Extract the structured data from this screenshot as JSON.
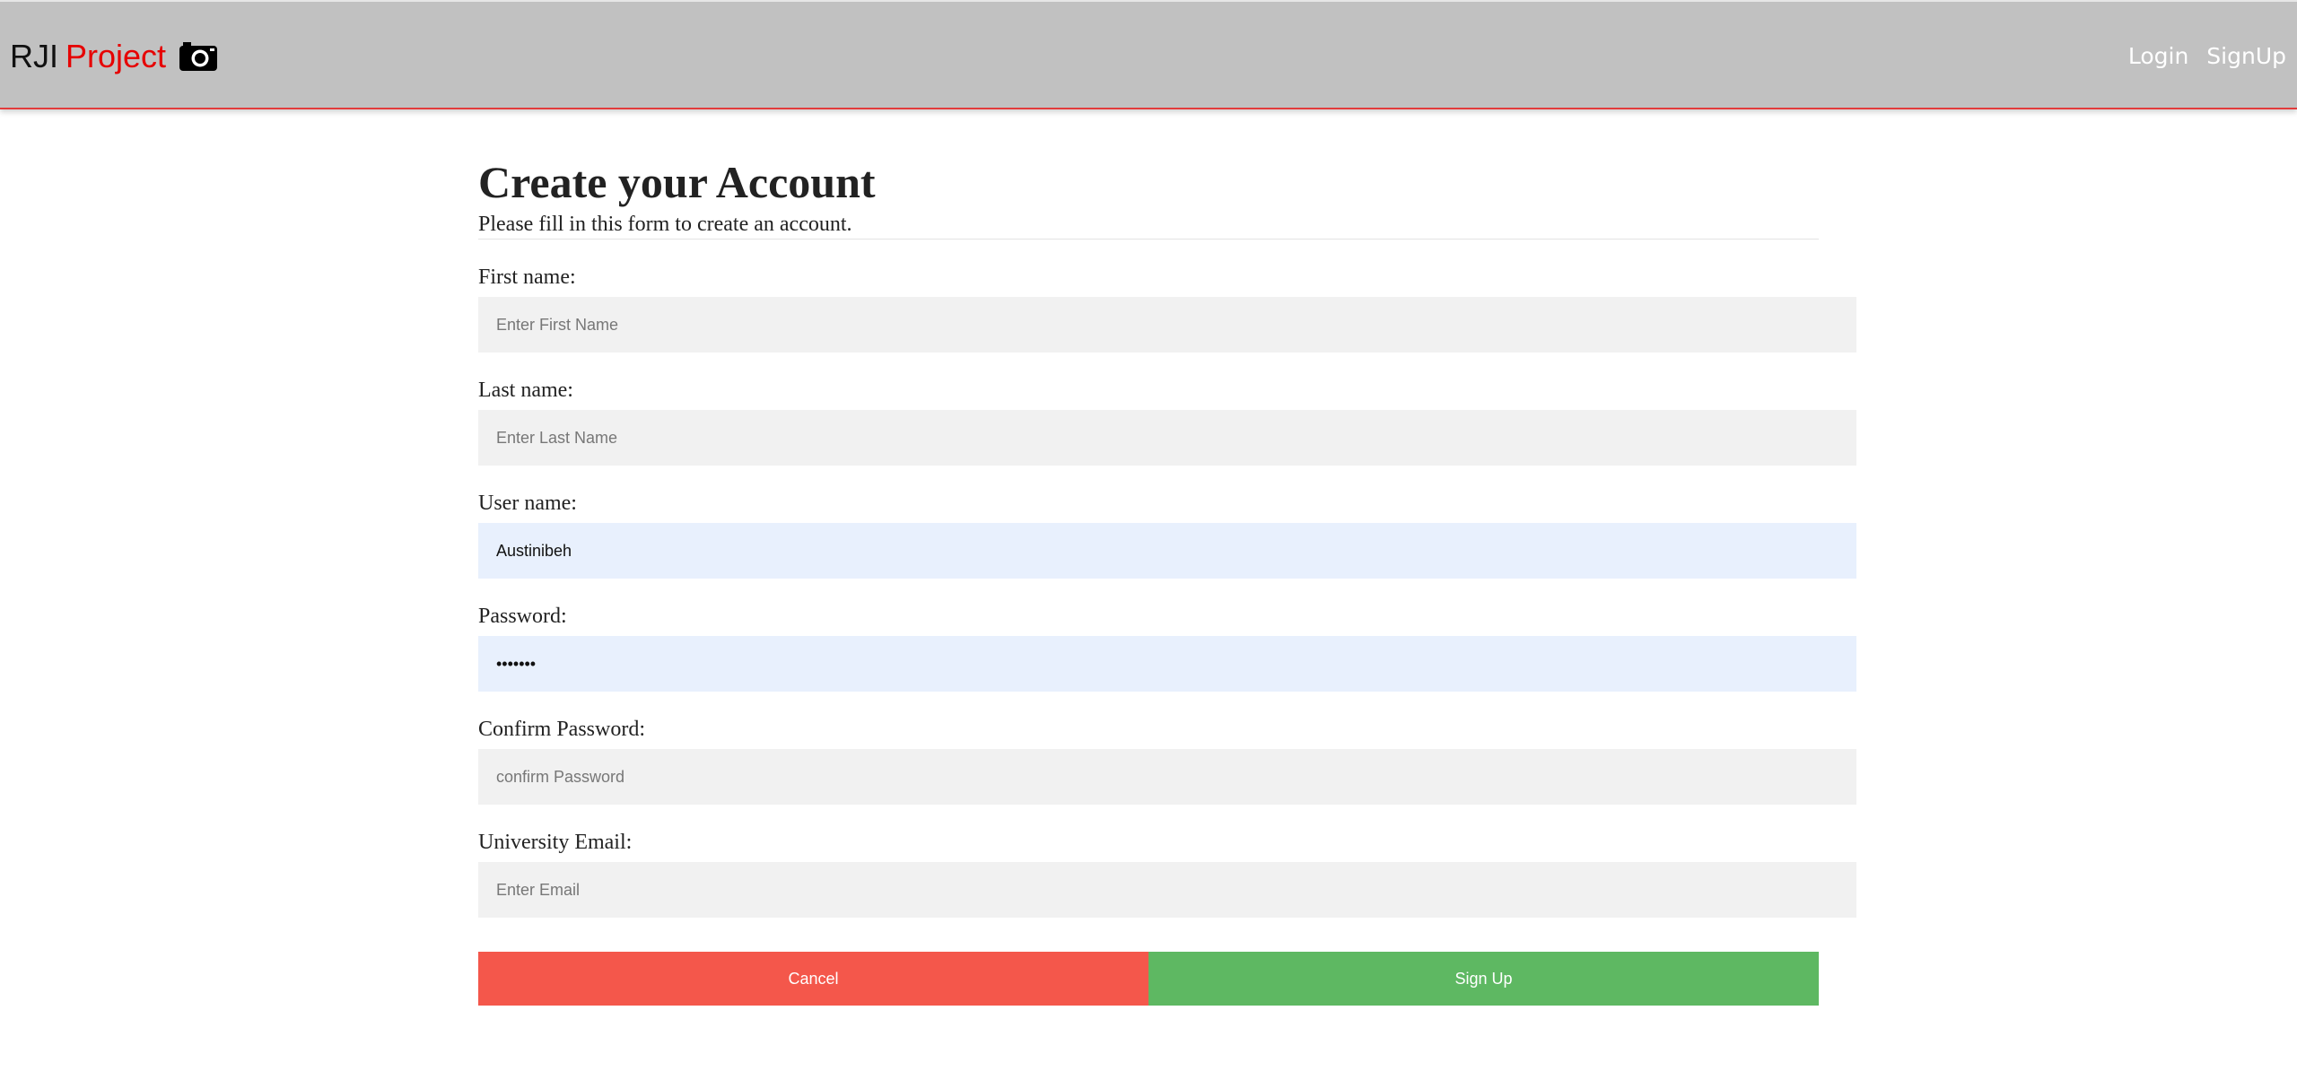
{
  "navbar": {
    "brand_part1": "RJI",
    "brand_part2": "Project",
    "brand_icon": "camera-icon",
    "login_label": "Login",
    "signup_label": "SignUp",
    "colors": {
      "bar_background": "#c1c1c1",
      "bar_accent_border": "#e23b3b",
      "brand_red": "#e60000"
    }
  },
  "form": {
    "title": "Create your Account",
    "subtitle": "Please fill in this form to create an account.",
    "fields": [
      {
        "label": "First name:",
        "placeholder": "Enter First Name",
        "value": ""
      },
      {
        "label": "Last name:",
        "placeholder": "Enter Last Name",
        "value": ""
      },
      {
        "label": "User name:",
        "placeholder": "",
        "value": "Austinibeh"
      },
      {
        "label": "Password:",
        "placeholder": "",
        "value": "•••••••"
      },
      {
        "label": "Confirm Password:",
        "placeholder": "confirm Password",
        "value": ""
      },
      {
        "label": "University Email:",
        "placeholder": "Enter Email",
        "value": ""
      }
    ],
    "cancel_label": "Cancel",
    "signup_label": "Sign Up",
    "colors": {
      "cancel": "#f4574b",
      "signup": "#5eb862",
      "autofill_input": "#e8f0fd",
      "input": "#f1f1f1"
    }
  }
}
